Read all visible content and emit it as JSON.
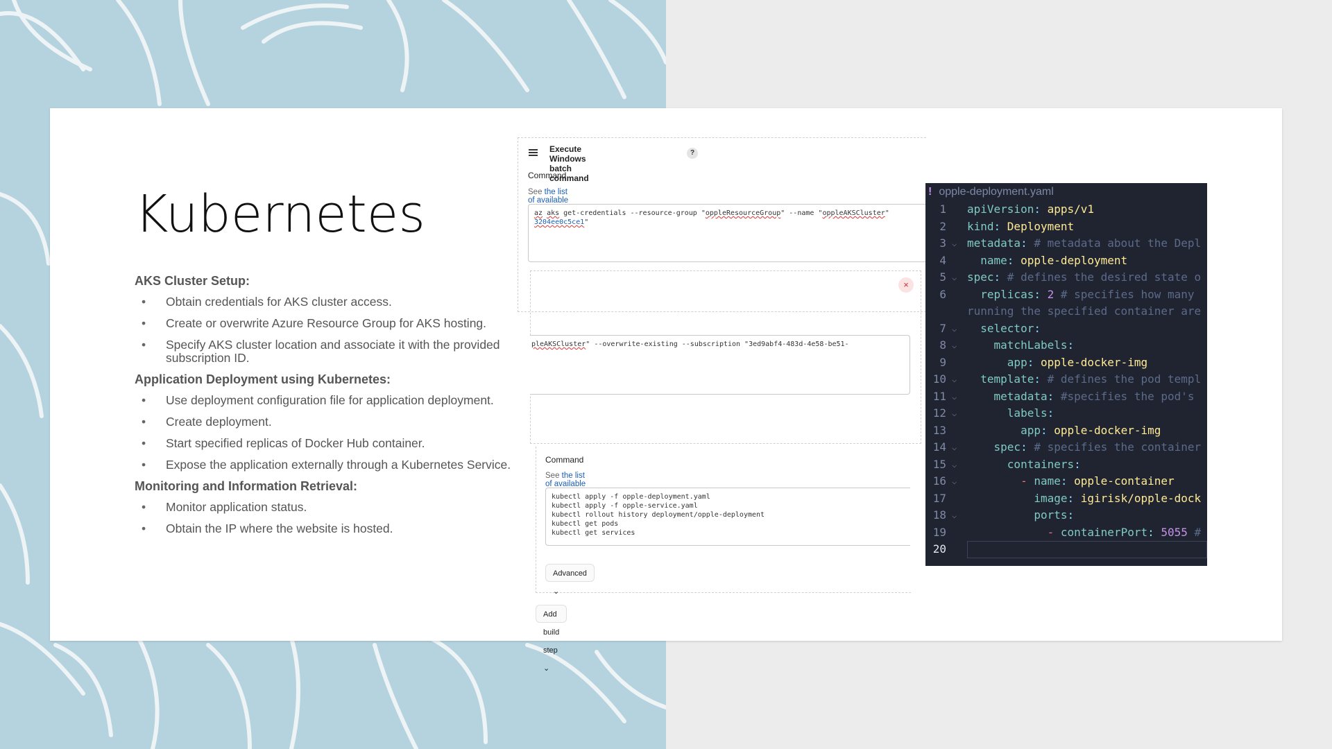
{
  "slide": {
    "title": "Kubernetes",
    "sections": [
      {
        "heading": "AKS Cluster Setup:",
        "items": [
          "Obtain credentials for AKS cluster access.",
          "Create or overwrite Azure Resource Group for AKS hosting.",
          "Specify AKS cluster location and associate it with the provided subscription ID."
        ]
      },
      {
        "heading": "Application Deployment using Kubernetes:",
        "items": [
          "Use deployment configuration file for application deployment.",
          "Create deployment.",
          "Start specified replicas of Docker Hub container.",
          "Expose the application externally through a Kubernetes Service."
        ]
      },
      {
        "heading": "Monitoring and Information Retrieval:",
        "items": [
          "Monitor application status.",
          "Obtain the IP where the website is hosted."
        ]
      }
    ]
  },
  "jenkins": {
    "step_title": "Execute Windows batch command",
    "help": "?",
    "command_label": "Command",
    "see_prefix": "See ",
    "env_link": "the list of available environment variables",
    "cmd1_line1_a": "az",
    "cmd1_line1_b": " ",
    "cmd1_line1_c": "aks",
    "cmd1_line1_d": " get-credentials --resource-group \"",
    "cmd1_line1_e": "oppleResourceGroup",
    "cmd1_line1_f": "\" --name \"",
    "cmd1_line1_g": "oppleAKSCluster",
    "cmd1_line1_h": "\"",
    "cmd1_line2": "3204ee0c5ce1",
    "cmd1_line2_end": "\"",
    "close": "×",
    "cmd2_a": "pleAKSCluster",
    "cmd2_b": "\" --overwrite-existing --subscription \"3ed9abf4-483d-4e58-be51-",
    "command_label2": "Command",
    "cmd3": "kubectl apply -f opple-deployment.yaml\nkubectl apply -f opple-service.yaml\nkubectl rollout history deployment/opple-deployment\nkubectl get pods\nkubectl get services",
    "advanced": "Advanced",
    "add_step": "Add build step"
  },
  "editor": {
    "filename": "opple-deployment.yaml",
    "modified_marker": "!",
    "lines": [
      {
        "n": "1"
      },
      {
        "n": "2"
      },
      {
        "n": "3"
      },
      {
        "n": "4"
      },
      {
        "n": "5"
      },
      {
        "n": "6"
      },
      {
        "n": ""
      },
      {
        "n": "7"
      },
      {
        "n": "8"
      },
      {
        "n": "9"
      },
      {
        "n": "10"
      },
      {
        "n": "11"
      },
      {
        "n": "12"
      },
      {
        "n": "13"
      },
      {
        "n": "14"
      },
      {
        "n": "15"
      },
      {
        "n": "16"
      },
      {
        "n": "17"
      },
      {
        "n": "18"
      },
      {
        "n": "19"
      },
      {
        "n": "20"
      }
    ],
    "t": {
      "l1k": "apiVersion",
      "l1v": "apps/v1",
      "l2k": "kind",
      "l2v": "Deployment",
      "l3k": "metadata",
      "l3c": "# metadata about the Depl",
      "l4k": "name",
      "l4v": "opple-deployment",
      "l5k": "spec",
      "l5c": "# defines the desired state o",
      "l6k": "replicas",
      "l6v": "2",
      "l6c": "# specifies how many",
      "l6b": "running the specified container are",
      "l7k": "selector",
      "l8k": "matchLabels",
      "l9k": "app",
      "l9v": "opple-docker-img",
      "l10k": "template",
      "l10c": "# defines the pod templ",
      "l11k": "metadata",
      "l11c": "#specifies the pod's",
      "l12k": "labels",
      "l13k": "app",
      "l13v": "opple-docker-img",
      "l14k": "spec",
      "l14c": "# specifies the container",
      "l15k": "containers",
      "l16d": "-",
      "l16k": "name",
      "l16v": "opple-container",
      "l17k": "image",
      "l17v": "igirisk/opple-dock",
      "l18k": "ports",
      "l19d": "-",
      "l19k": "containerPort",
      "l19v": "5055",
      "l19c": "#"
    }
  },
  "colors": {
    "background_left": "#b5d3df",
    "background_right": "#ececec",
    "editor_bg": "#1f2430",
    "link": "#1a5fb4"
  }
}
